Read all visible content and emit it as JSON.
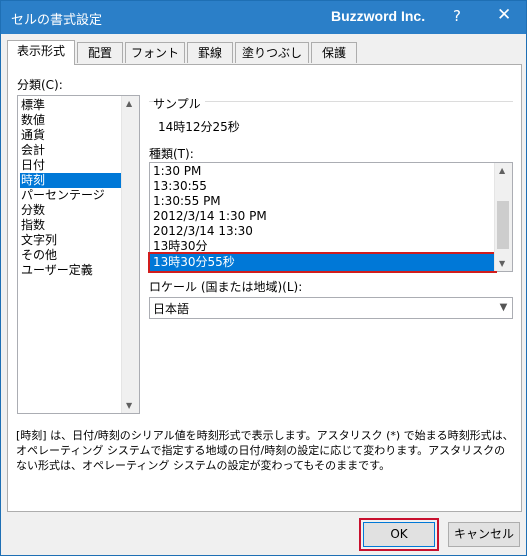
{
  "window": {
    "title": "セルの書式設定",
    "brand": "Buzzword Inc.",
    "help_label": "?",
    "close_label": "✕"
  },
  "tabs": [
    {
      "label": "表示形式",
      "active": true
    },
    {
      "label": "配置"
    },
    {
      "label": "フォント"
    },
    {
      "label": "罫線"
    },
    {
      "label": "塗りつぶし"
    },
    {
      "label": "保護"
    }
  ],
  "category": {
    "label": "分類(C):",
    "items": [
      "標準",
      "数値",
      "通貨",
      "会計",
      "日付",
      "時刻",
      "パーセンテージ",
      "分数",
      "指数",
      "文字列",
      "その他",
      "ユーザー定義"
    ],
    "selected": "時刻"
  },
  "sample": {
    "label": "サンプル",
    "value": "14時12分25秒"
  },
  "type": {
    "label": "種類(T):",
    "items": [
      "1:30 PM",
      "13:30:55",
      "1:30:55 PM",
      "2012/3/14 1:30 PM",
      "2012/3/14 13:30",
      "13時30分",
      "13時30分55秒"
    ],
    "selected": "13時30分55秒"
  },
  "locale": {
    "label": "ロケール (国または地域)(L):",
    "value": "日本語"
  },
  "description": "[時刻] は、日付/時刻のシリアル値を時刻形式で表示します。アスタリスク (*) で始まる時刻形式は、オペレーティング システムで指定する地域の日付/時刻の設定に応じて変わります。アスタリスクのない形式は、オペレーティング システムの設定が変わってもそのままです。",
  "buttons": {
    "ok": "OK",
    "cancel": "キャンセル"
  },
  "colors": {
    "titlebar": "#2b7fc8",
    "selection": "#0078d7",
    "highlight_border": "#d11d1d"
  }
}
